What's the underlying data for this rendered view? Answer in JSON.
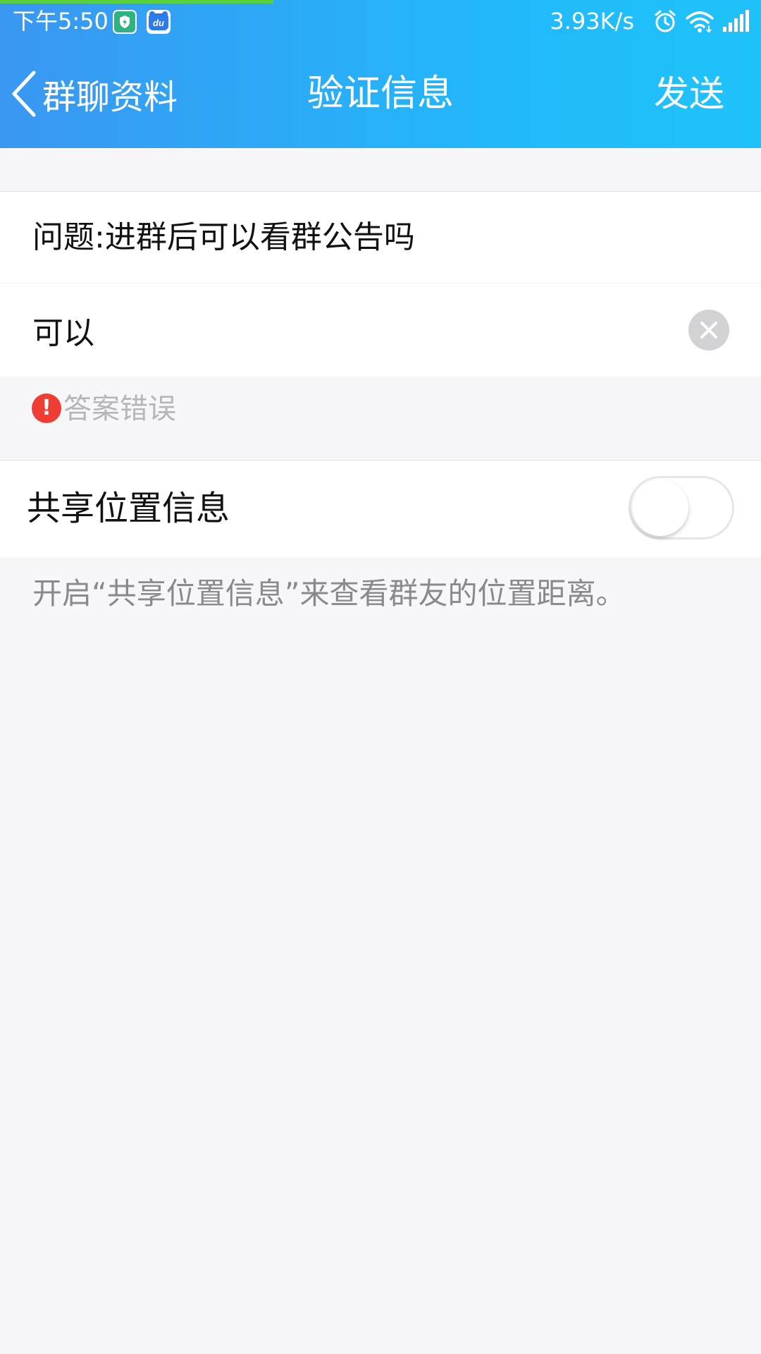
{
  "status_bar": {
    "time": "下午5:50",
    "network_speed": "3.93K/s",
    "icons": [
      "shield-app-icon",
      "du-app-icon",
      "alarm-icon",
      "wifi-icon",
      "signal-icon"
    ]
  },
  "nav": {
    "back_label": "群聊资料",
    "title": "验证信息",
    "send_label": "发送"
  },
  "form": {
    "question": "问题:进群后可以看群公告吗",
    "answer_value": "可以",
    "error_text": "答案错误",
    "error_icon_glyph": "!"
  },
  "share_location": {
    "label": "共享位置信息",
    "enabled": false,
    "hint": "开启“共享位置信息”来查看群友的位置距离。"
  },
  "colors": {
    "header_start": "#3a97f1",
    "header_end": "#1fc3fb",
    "error_red": "#ef3d35",
    "page_background": "#f7f7f9"
  }
}
